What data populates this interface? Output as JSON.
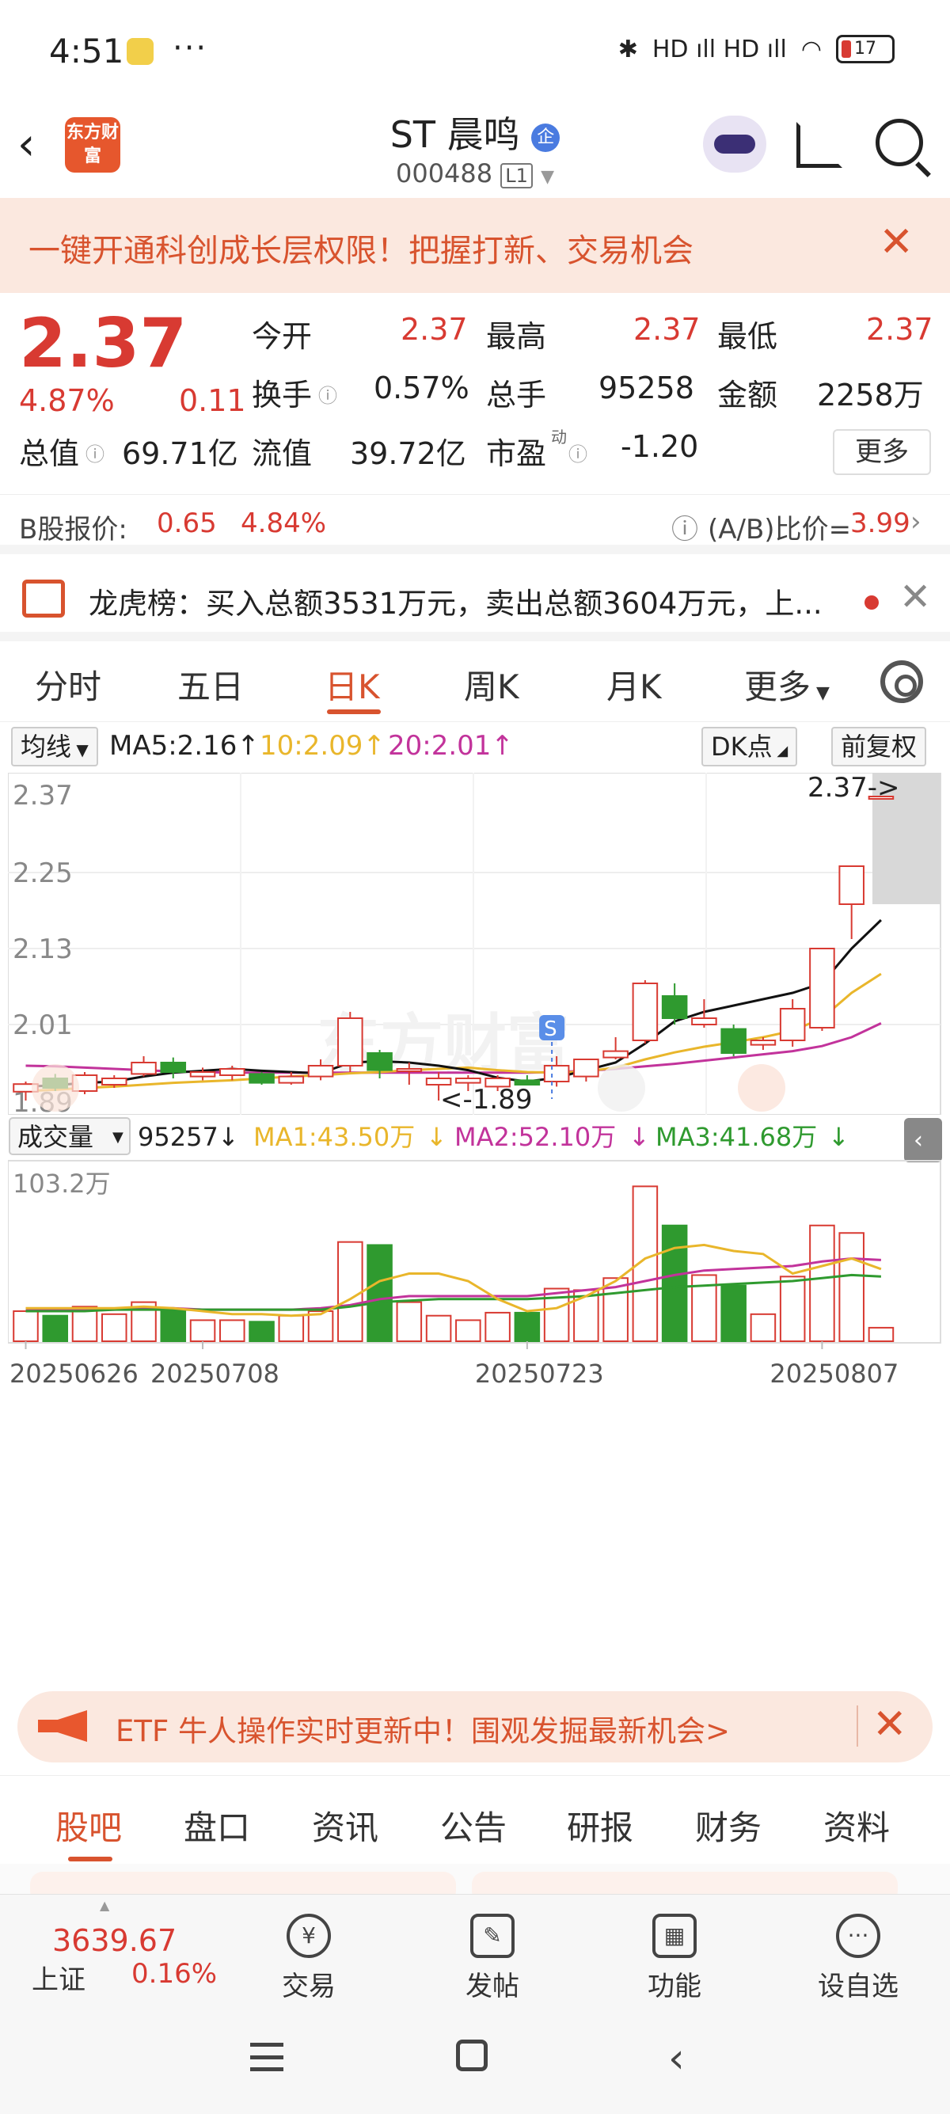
{
  "status_bar": {
    "time": "4:51",
    "more": "···",
    "network": "HD ıll HD ıll",
    "battery": "17"
  },
  "header": {
    "logo_text": "东方财富",
    "stock_name": "ST 晨鸣",
    "badge": "企",
    "stock_code": "000488",
    "code_tag": "L1"
  },
  "banner_top": {
    "text": "一键开通科创成长层权限！把握打新、交易机会"
  },
  "quote": {
    "price": "2.37",
    "pct": "4.87%",
    "change": "0.11",
    "fields": [
      {
        "label": "今开",
        "value": "2.37"
      },
      {
        "label": "最高",
        "value": "2.37"
      },
      {
        "label": "最低",
        "value": "2.37"
      },
      {
        "label": "换手",
        "value": "0.57%"
      },
      {
        "label": "总手",
        "value": "95258"
      },
      {
        "label": "金额",
        "value": "2258万"
      },
      {
        "label": "总值",
        "value": "69.71亿"
      },
      {
        "label": "流值",
        "value": "39.72亿"
      },
      {
        "label": "市盈",
        "value": "-1.20"
      }
    ],
    "dyn_mark": "动",
    "more_btn": "更多"
  },
  "b_quote": {
    "label": "B股报价:",
    "price": "0.65",
    "pct": "4.84%",
    "ratio_label": "(A/B)比价=",
    "ratio": "3.99"
  },
  "lhb": {
    "text": "龙虎榜：买入总额3531万元，卖出总额3604万元，上..."
  },
  "kline_tabs": [
    "分时",
    "五日",
    "日K",
    "周K",
    "月K",
    "更多"
  ],
  "ma_bar": {
    "selector": "均线",
    "ma5": "MA5:2.16",
    "ma10": "10:2.09",
    "ma20": "20:2.01",
    "dk": "DK点",
    "adjust": "前复权"
  },
  "vol_bar": {
    "selector": "成交量",
    "vol": "95257",
    "ma1": "MA1:43.50万",
    "ma2": "MA2:52.10万",
    "ma3": "MA3:41.68万"
  },
  "colors": {
    "up": "#d83a32",
    "down": "#2f9a2f",
    "ma5": "#111111",
    "ma10": "#e9b62b",
    "ma20": "#c2339b",
    "brand": "#d8532e"
  },
  "chart_data": {
    "type": "candlestick",
    "price_ticks": [
      "2.37",
      "2.25",
      "2.13",
      "2.01",
      "1.89"
    ],
    "ylim": [
      1.89,
      2.37
    ],
    "vol_max_label": "103.2万",
    "vol_ylim": [
      0,
      103.2
    ],
    "date_labels": [
      {
        "label": "20250626",
        "index": 0
      },
      {
        "label": "20250708",
        "index": 6
      },
      {
        "label": "20250723",
        "index": 17
      },
      {
        "label": "20250807",
        "index": 27
      }
    ],
    "annotation_high": "2.37->",
    "annotation_low": "<-1.89",
    "signal_marker": "S",
    "candles": [
      {
        "o": 1.904,
        "h": 1.92,
        "l": 1.89,
        "c": 1.916,
        "v": 20
      },
      {
        "o": 1.925,
        "h": 1.932,
        "l": 1.905,
        "c": 1.91,
        "v": 17
      },
      {
        "o": 1.905,
        "h": 1.935,
        "l": 1.9,
        "c": 1.93,
        "v": 23
      },
      {
        "o": 1.915,
        "h": 1.93,
        "l": 1.91,
        "c": 1.925,
        "v": 18
      },
      {
        "o": 1.932,
        "h": 1.96,
        "l": 1.928,
        "c": 1.95,
        "v": 26
      },
      {
        "o": 1.95,
        "h": 1.958,
        "l": 1.925,
        "c": 1.935,
        "v": 21
      },
      {
        "o": 1.928,
        "h": 1.942,
        "l": 1.922,
        "c": 1.935,
        "v": 14
      },
      {
        "o": 1.93,
        "h": 1.945,
        "l": 1.922,
        "c": 1.94,
        "v": 14
      },
      {
        "o": 1.932,
        "h": 1.935,
        "l": 1.915,
        "c": 1.918,
        "v": 13
      },
      {
        "o": 1.918,
        "h": 1.935,
        "l": 1.915,
        "c": 1.928,
        "v": 17
      },
      {
        "o": 1.928,
        "h": 1.955,
        "l": 1.922,
        "c": 1.945,
        "v": 20
      },
      {
        "o": 1.945,
        "h": 2.03,
        "l": 1.935,
        "c": 2.02,
        "v": 66
      },
      {
        "o": 1.965,
        "h": 1.97,
        "l": 1.925,
        "c": 1.938,
        "v": 64
      },
      {
        "o": 1.938,
        "h": 1.95,
        "l": 1.915,
        "c": 1.94,
        "v": 26
      },
      {
        "o": 1.915,
        "h": 1.935,
        "l": 1.89,
        "c": 1.925,
        "v": 17
      },
      {
        "o": 1.918,
        "h": 1.93,
        "l": 1.905,
        "c": 1.925,
        "v": 14
      },
      {
        "o": 1.912,
        "h": 1.93,
        "l": 1.905,
        "c": 1.925,
        "v": 19
      },
      {
        "o": 1.922,
        "h": 1.93,
        "l": 1.915,
        "c": 1.915,
        "v": 19
      },
      {
        "o": 1.92,
        "h": 1.96,
        "l": 1.912,
        "c": 1.945,
        "v": 35
      },
      {
        "o": 1.928,
        "h": 1.945,
        "l": 1.92,
        "c": 1.955,
        "v": 34
      },
      {
        "o": 1.958,
        "h": 1.99,
        "l": 1.955,
        "c": 1.968,
        "v": 42
      },
      {
        "o": 1.985,
        "h": 2.08,
        "l": 1.98,
        "c": 2.075,
        "v": 103
      },
      {
        "o": 2.055,
        "h": 2.075,
        "l": 2.01,
        "c": 2.02,
        "v": 77
      },
      {
        "o": 2.01,
        "h": 2.05,
        "l": 2.005,
        "c": 2.02,
        "v": 44
      },
      {
        "o": 2.003,
        "h": 2.01,
        "l": 1.96,
        "c": 1.965,
        "v": 37
      },
      {
        "o": 1.978,
        "h": 1.99,
        "l": 1.97,
        "c": 1.985,
        "v": 18
      },
      {
        "o": 1.985,
        "h": 2.05,
        "l": 1.975,
        "c": 2.035,
        "v": 43
      },
      {
        "o": 2.005,
        "h": 2.13,
        "l": 2.0,
        "c": 2.13,
        "v": 77
      },
      {
        "o": 2.2,
        "h": 2.26,
        "l": 2.145,
        "c": 2.26,
        "v": 72
      },
      {
        "o": 2.37,
        "h": 2.37,
        "l": 2.37,
        "c": 2.37,
        "v": 9
      }
    ],
    "ma_lines": {
      "ma5": [
        1.912,
        1.914,
        1.918,
        1.92,
        1.928,
        1.934,
        1.937,
        1.94,
        1.937,
        1.935,
        1.933,
        1.95,
        1.952,
        1.95,
        1.945,
        1.938,
        1.926,
        1.92,
        1.926,
        1.938,
        1.95,
        1.98,
        2.015,
        2.03,
        2.04,
        2.05,
        2.06,
        2.075,
        2.13,
        2.175
      ],
      "ma10": [
        1.905,
        1.907,
        1.91,
        1.912,
        1.915,
        1.918,
        1.92,
        1.922,
        1.925,
        1.928,
        1.93,
        1.933,
        1.935,
        1.938,
        1.94,
        1.942,
        1.938,
        1.935,
        1.934,
        1.936,
        1.942,
        1.955,
        1.966,
        1.975,
        1.982,
        1.99,
        2.0,
        2.02,
        2.06,
        2.09
      ],
      "ma20": [
        1.945,
        1.944,
        1.942,
        1.94,
        1.938,
        1.936,
        1.935,
        1.934,
        1.934,
        1.934,
        1.934,
        1.934,
        1.934,
        1.934,
        1.934,
        1.934,
        1.934,
        1.934,
        1.935,
        1.937,
        1.94,
        1.944,
        1.948,
        1.953,
        1.958,
        1.963,
        1.968,
        1.976,
        1.99,
        2.012
      ],
      "vma1": [
        22,
        22,
        22,
        22,
        23,
        22,
        20,
        18,
        18,
        17,
        18,
        28,
        40,
        45,
        45,
        40,
        28,
        20,
        22,
        30,
        40,
        55,
        62,
        64,
        60,
        58,
        45,
        50,
        55,
        48
      ],
      "vma2": [
        21,
        21,
        21,
        21,
        22,
        22,
        21,
        21,
        21,
        21,
        22,
        24,
        28,
        30,
        30,
        30,
        30,
        30,
        32,
        34,
        36,
        40,
        44,
        47,
        48,
        49,
        50,
        53,
        55,
        54
      ],
      "vma3": [
        20,
        20,
        20,
        21,
        21,
        21,
        21,
        21,
        21,
        21,
        21,
        23,
        26,
        27,
        28,
        28,
        28,
        28,
        29,
        30,
        32,
        34,
        36,
        37,
        38,
        39,
        40,
        42,
        44,
        43
      ]
    }
  },
  "banner_bottom": {
    "text": "ETF 牛人操作实时更新中！围观发掘最新机会>"
  },
  "sub_tabs": [
    "股吧",
    "盘口",
    "资讯",
    "公告",
    "研报",
    "财务",
    "资料"
  ],
  "bottom_nav": {
    "index_value": "3639.67",
    "index_name": "上证",
    "index_pct": "0.16%",
    "items": [
      {
        "label": "交易",
        "icon": "yen-icon"
      },
      {
        "label": "发帖",
        "icon": "edit-icon"
      },
      {
        "label": "功能",
        "icon": "grid-icon"
      },
      {
        "label": "设自选",
        "icon": "more-icon"
      }
    ]
  }
}
